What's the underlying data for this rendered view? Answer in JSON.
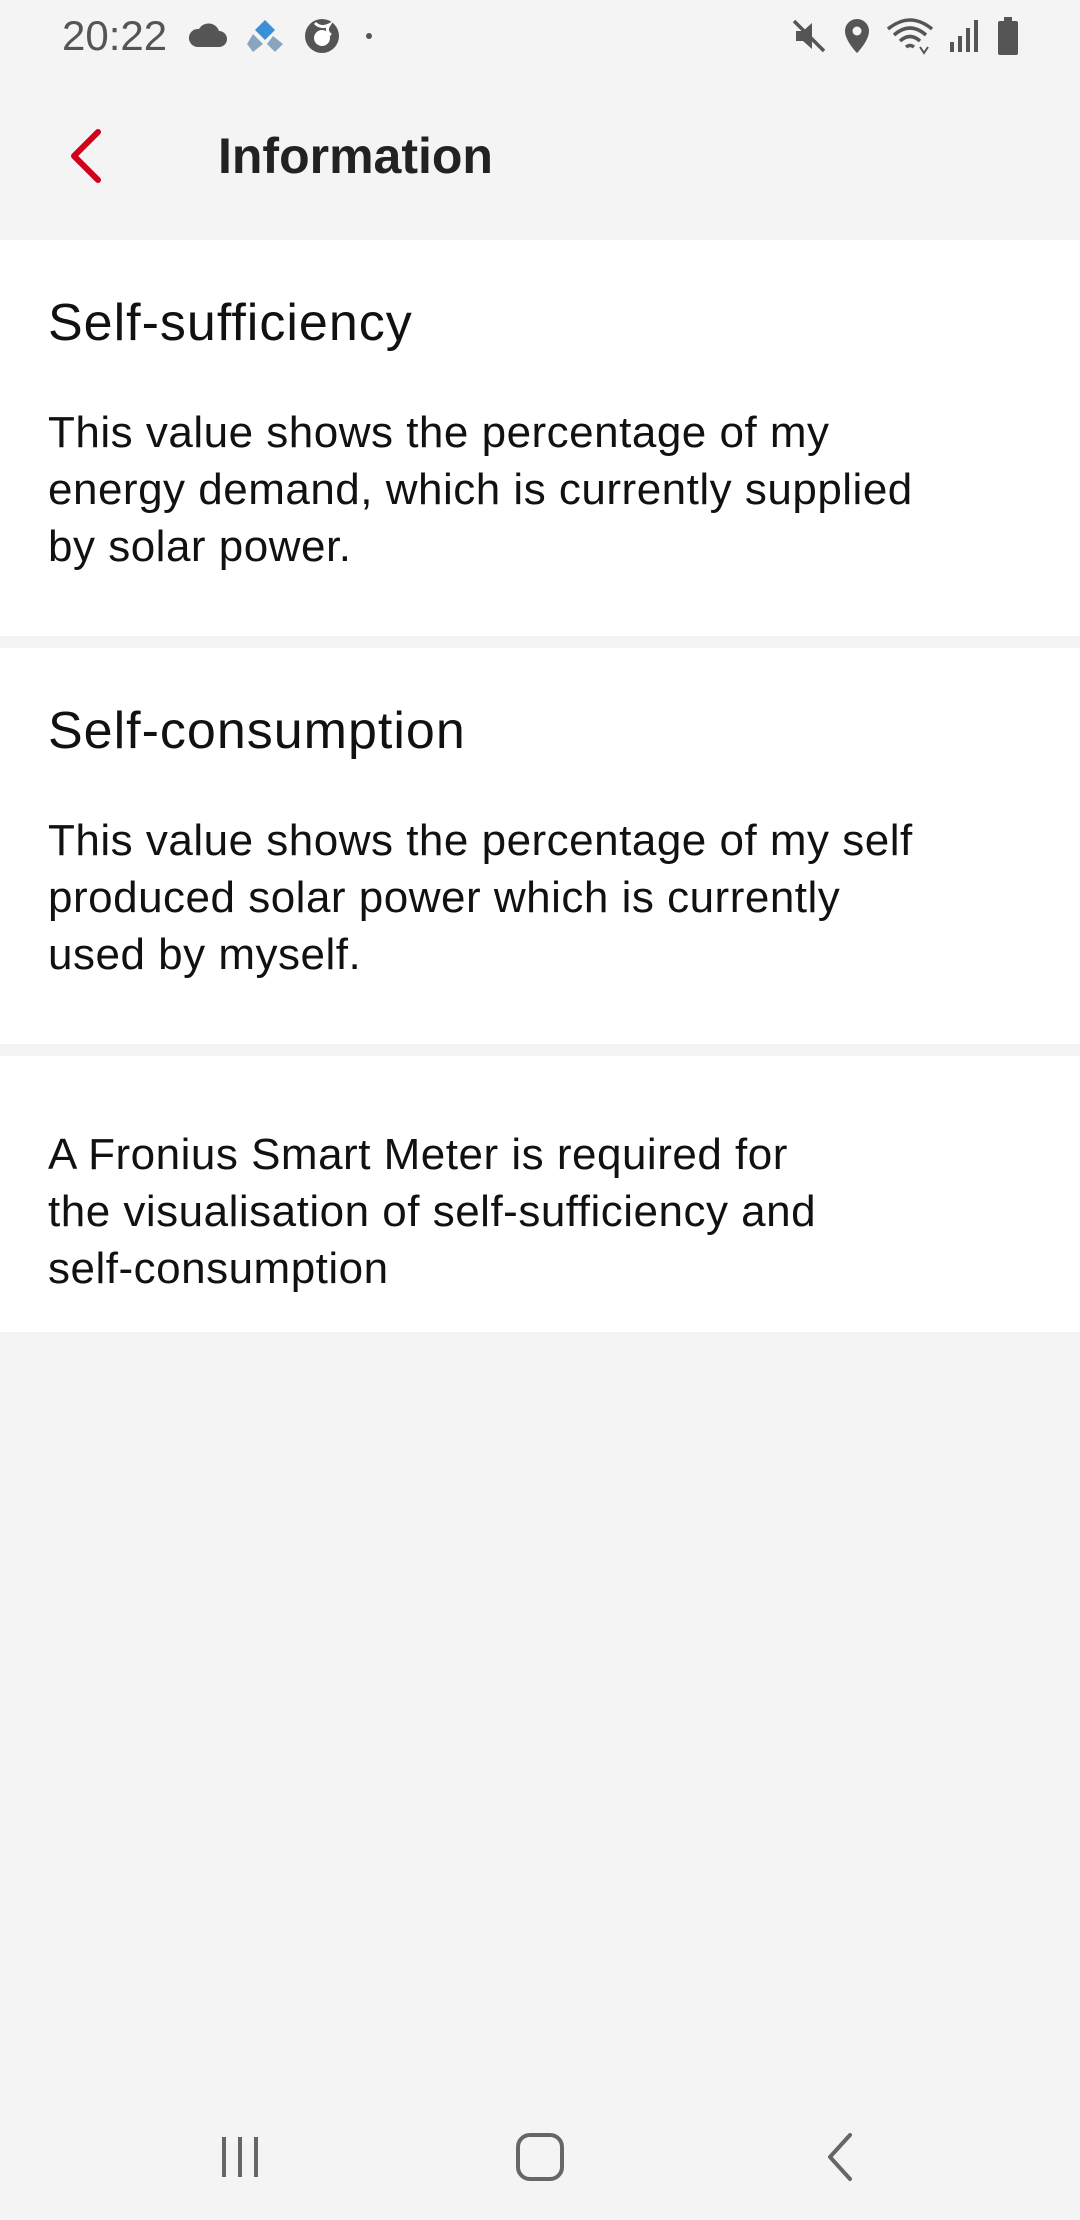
{
  "status_bar": {
    "time": "20:22",
    "left_icons": [
      "cloud-icon",
      "app-notification-icon",
      "firefox-icon",
      "dot-icon"
    ],
    "right_icons": [
      "mute-icon",
      "location-icon",
      "wifi-icon",
      "signal-icon",
      "battery-icon"
    ]
  },
  "app_bar": {
    "back_icon": "chevron-left-icon",
    "title": "Information",
    "accent_color": "#d0021b"
  },
  "sections": [
    {
      "heading": "Self-sufficiency",
      "text": "This value shows the percentage of my\nenergy demand, which is currently supplied\nby solar power."
    },
    {
      "heading": "Self-consumption",
      "text": "This value shows the percentage of my self\nproduced solar power which is currently\nused by myself."
    }
  ],
  "note": {
    "text": "A Fronius Smart Meter is required for\nthe visualisation of self-sufficiency and\nself-consumption"
  },
  "nav_bar": {
    "buttons": [
      "recent-apps-icon",
      "home-icon",
      "back-icon"
    ]
  }
}
